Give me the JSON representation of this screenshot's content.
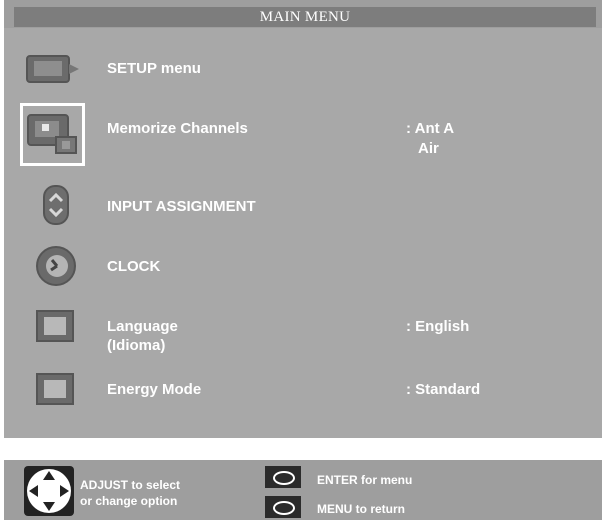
{
  "title": "MAIN MENU",
  "menu": [
    {
      "label": "SETUP menu",
      "icon": "setup-monitor-icon"
    },
    {
      "label": "Memorize Channels",
      "icon": "memorize-channels-icon",
      "value": ":  Ant A",
      "value2": "Air",
      "selected": true
    },
    {
      "label": "INPUT ASSIGNMENT",
      "icon": "input-assignment-icon"
    },
    {
      "label": "CLOCK",
      "icon": "clock-icon"
    },
    {
      "label": "Language",
      "label2": "(Idioma)",
      "icon": "language-icon",
      "value": ": English"
    },
    {
      "label": "Energy Mode",
      "icon": "energy-mode-icon",
      "value": ": Standard"
    }
  ],
  "footer": {
    "adjust_line1": "ADJUST to select",
    "adjust_line2": "or  change option",
    "enter_label": "ENTER for menu",
    "menu_label": "MENU  to  return"
  },
  "colors": {
    "accent_white": "#ffffff",
    "panel_gray": "#a8a8a8",
    "title_gray": "#7d7d7d"
  }
}
